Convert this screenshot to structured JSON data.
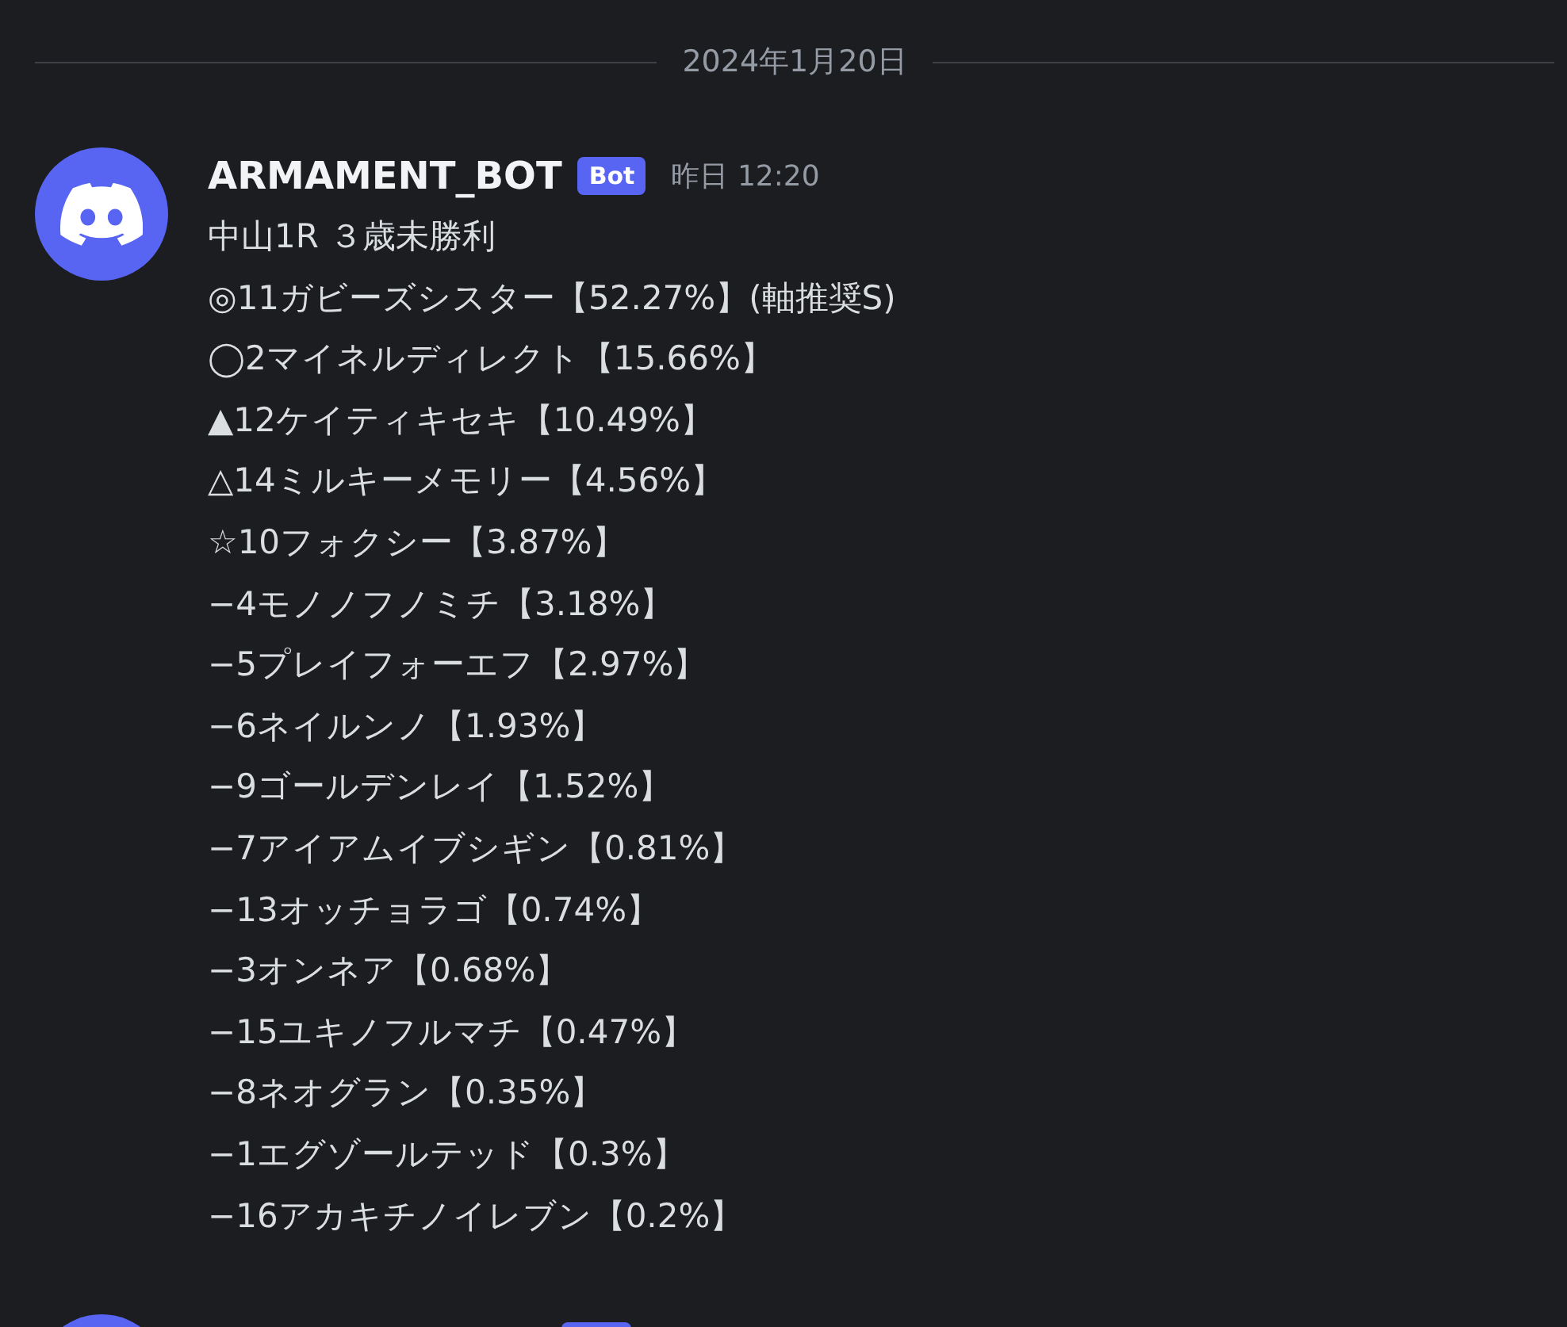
{
  "date_divider": "2024年1月20日",
  "messages": [
    {
      "author": "ARMAMENT_BOT",
      "badge": "Bot",
      "timestamp": "昨日 12:20",
      "lines": [
        "中山1R ３歳未勝利",
        "◎11ガビーズシスター【52.27%】(軸推奨S)",
        "◯2マイネルディレクト【15.66%】",
        "▲12ケイティキセキ【10.49%】",
        "△14ミルキーメモリー【4.56%】",
        "☆10フォクシー【3.87%】",
        "−4モノノフノミチ【3.18%】",
        "−5プレイフォーエフ【2.97%】",
        "−6ネイルンノ【1.93%】",
        "−9ゴールデンレイ【1.52%】",
        "−7アイアムイブシギン【0.81%】",
        "−13オッチョラゴ【0.74%】",
        "−3オンネア【0.68%】",
        "−15ユキノフルマチ【0.47%】",
        "−8ネオグラン【0.35%】",
        "−1エグゾールテッド【0.3%】",
        "−16アカキチノイレブン【0.2%】"
      ]
    },
    {
      "kind": "cut_off"
    }
  ]
}
